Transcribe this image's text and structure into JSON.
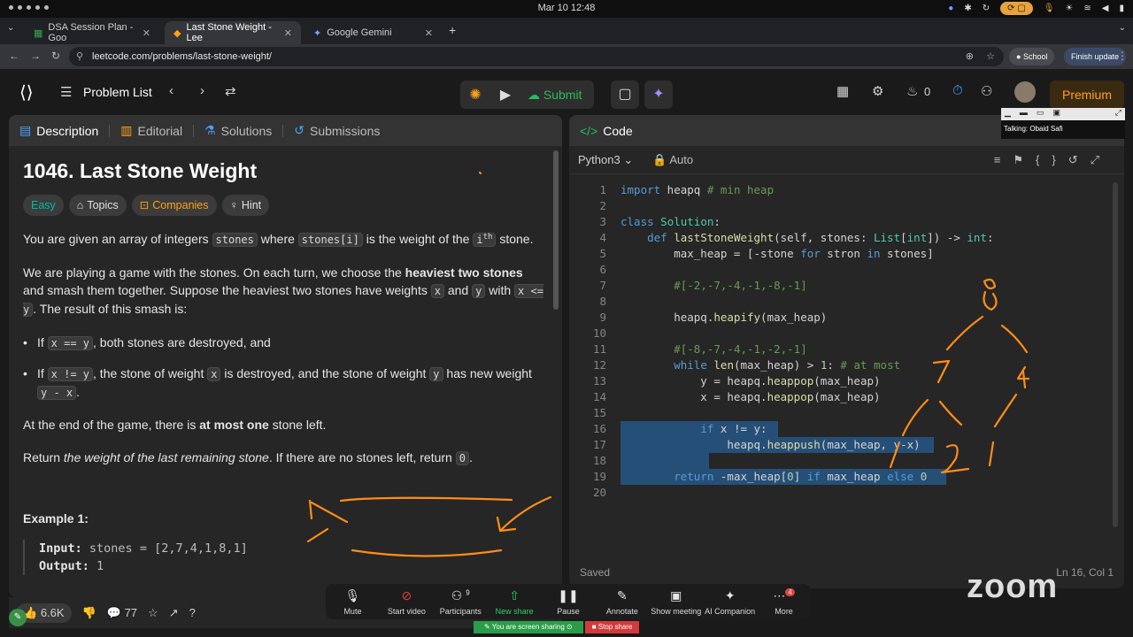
{
  "os": {
    "clock": "Mar 10  12:48"
  },
  "tabs": [
    {
      "label": "DSA Session Plan - Goo"
    },
    {
      "label": "Last Stone Weight - Lee"
    },
    {
      "label": "Google Gemini"
    }
  ],
  "address": {
    "url": "leetcode.com/problems/last-stone-weight/",
    "profile": "School",
    "update": "Finish update"
  },
  "nav": {
    "problem_list": "Problem List",
    "submit": "Submit",
    "streak": "0",
    "premium": "Premium"
  },
  "left_tabs": [
    "Description",
    "Editorial",
    "Solutions",
    "Submissions"
  ],
  "problem": {
    "title": "1046. Last Stone Weight",
    "difficulty": "Easy",
    "chips": [
      "Topics",
      "Companies",
      "Hint"
    ],
    "p1_a": "You are given an array of integers ",
    "p1_code1": "stones",
    "p1_b": " where ",
    "p1_code2": "stones[i]",
    "p1_c": " is the weight of the ",
    "p1_i": "i",
    "p1_sup": "th",
    "p1_d": " stone.",
    "p2_a": "We are playing a game with the stones. On each turn, we choose the ",
    "p2_bold": "heaviest two stones",
    "p2_b": " and smash them together. Suppose the heaviest two stones have weights ",
    "p2_x": "x",
    "p2_and": " and ",
    "p2_y": "y",
    "p2_with": " with ",
    "p2_cond": "x <= y",
    "p2_c": ". The result of this smash is:",
    "b1_a": "If ",
    "b1_code": "x == y",
    "b1_b": ", both stones are destroyed, and",
    "b2_a": "If ",
    "b2_code": "x != y",
    "b2_b": ", the stone of weight ",
    "b2_x": "x",
    "b2_c": " is destroyed, and the stone of weight ",
    "b2_y": "y",
    "b2_d": " has new weight ",
    "b2_code2": "y - x",
    "b2_e": ".",
    "p3_a": "At the end of the game, there is ",
    "p3_bold": "at most one",
    "p3_b": " stone left.",
    "p4_a": "Return ",
    "p4_em": "the weight of the last remaining stone",
    "p4_b": ". If there are no stones left, return ",
    "p4_code": "0",
    "p4_c": ".",
    "example_title": "Example 1:",
    "ex_input_label": "Input:",
    "ex_input": "stones = [2,7,4,1,8,1]",
    "ex_output_label": "Output:",
    "ex_output": "1"
  },
  "footer": {
    "likes": "6.6K",
    "comments": "77"
  },
  "editor": {
    "tab": "Code",
    "language": "Python3",
    "mode": "Auto",
    "status": "Saved",
    "position": "Ln 16, Col 1"
  },
  "code_lines": [
    "import heapq # min heap",
    "",
    "class Solution:",
    "    def lastStoneWeight(self, stones: List[int]) -> int:",
    "        max_heap = [-stone for stron in stones]",
    "",
    "        #[-2,-7,-4,-1,-8,-1]",
    "",
    "        heapq.heapify(max_heap)",
    "",
    "        #[-8,-7,-4,-1,-2,-1]",
    "        while len(max_heap) > 1: # at most",
    "            y = heapq.heappop(max_heap)",
    "            x = heapq.heappop(max_heap)",
    "",
    "            if x != y:",
    "                heapq.heappush(max_heap, y-x)",
    "",
    "        return -max_heap[0] if max_heap else 0",
    ""
  ],
  "zoom": {
    "buttons": [
      "Mute",
      "Start video",
      "Participants",
      "New share",
      "Pause",
      "Annotate",
      "Show meeting",
      "AI Companion",
      "More"
    ],
    "participants_count": "9",
    "more_badge": "4",
    "sharing": "You are screen sharing",
    "stop": "Stop share",
    "talking": "Talking: Obaid Safi",
    "logo": "zoom"
  },
  "colors": {
    "accent": "#ffa116",
    "submit": "#2cbb5d",
    "easy": "#00b8a3",
    "annotation": "#ff8c1a",
    "selection": "#264f78"
  }
}
